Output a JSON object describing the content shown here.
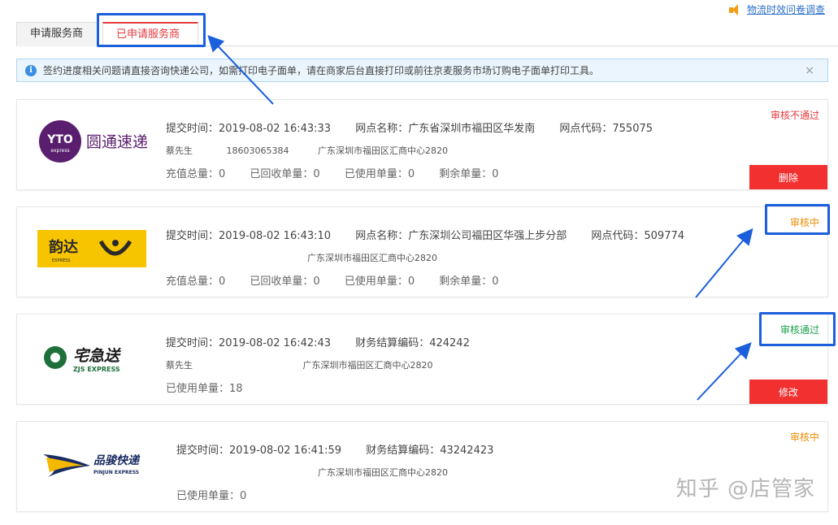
{
  "survey": {
    "label": "物流时效问卷调查"
  },
  "tabs": [
    {
      "label": "申请服务商"
    },
    {
      "label": "已申请服务商"
    }
  ],
  "notice": {
    "text": "签约进度相关问题请直接咨询快递公司，如需打印电子面单，请在商家后台直接打印或前往京麦服务市场订购电子面单打印工具。",
    "close": "×"
  },
  "cards": [
    {
      "logo_text": "圆通速递",
      "logo_mark": "YTO",
      "submit": "提交时间：2019-08-02 16:43:33",
      "branch": "网点名称：广东省深圳市福田区华发南",
      "code": "网点代码：755075",
      "contact": "蔡先生",
      "phone": "18603065384",
      "address": "广东深圳市福田区汇商中心2820",
      "total": "充值总量：0",
      "recycled": "已回收单量：0",
      "used": "已使用单量：0",
      "remaining": "剩余单量：0",
      "status": "审核不通过",
      "button": "删除"
    },
    {
      "logo_text": "韵达",
      "submit": "提交时间：2019-08-02 16:43:10",
      "branch": "网点名称：广东深圳公司福田区华强上步分部",
      "code": "网点代码：509774",
      "address": "广东深圳市福田区汇商中心2820",
      "total": "充值总量：0",
      "recycled": "已回收单量：0",
      "used": "已使用单量：0",
      "remaining": "剩余单量：0",
      "status": "审核中"
    },
    {
      "logo_text": "宅急送",
      "logo_sub": "ZJS EXPRESS",
      "submit": "提交时间：2019-08-02 16:42:43",
      "finance": "财务结算编码：424242",
      "contact": "蔡先生",
      "address": "广东深圳市福田区汇商中心2820",
      "used": "已使用单量：18",
      "status": "审核通过",
      "button": "修改"
    },
    {
      "logo_text": "品骏快递",
      "logo_sub": "PINJUN EXPRESS",
      "submit": "提交时间：2019-08-02 16:41:59",
      "finance": "财务结算编码：43242423",
      "address": "广东深圳市福田区汇商中心2820",
      "used": "已使用单量：0",
      "status": "审核中"
    }
  ],
  "watermark": "知乎 @店管家",
  "colors": {
    "accent": "#e4393c",
    "annotation": "#1b5fdc",
    "pass": "#1aa14b",
    "pending": "#f08c00"
  }
}
